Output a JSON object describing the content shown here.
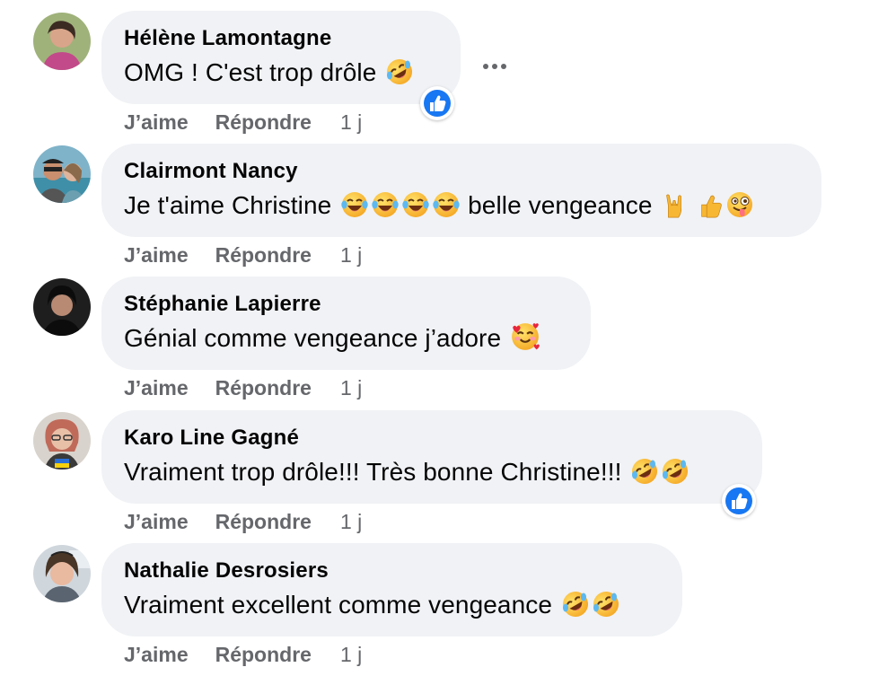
{
  "actions": {
    "like": "J’aime",
    "reply": "Répondre"
  },
  "comments": [
    {
      "author": "Hélène Lamontagne",
      "text": "OMG ! C'est trop drôle",
      "time": "1 j",
      "emojis": [
        "rofl-emoji"
      ],
      "reactions": [
        "like-reaction-icon"
      ]
    },
    {
      "author": "Clairmont Nancy",
      "text": "Je t'aime Christine",
      "text2": "belle vengeance",
      "time": "1 j",
      "emojis": [
        "joy-emoji",
        "joy-emoji",
        "joy-emoji",
        "joy-emoji",
        "rock-on-emoji",
        "thumbs-up-emoji",
        "tongue-wink-emoji"
      ],
      "reactions": []
    },
    {
      "author": "Stéphanie Lapierre",
      "text": "Génial comme vengeance j’adore",
      "time": "1 j",
      "emojis": [
        "smiling-hearts-emoji"
      ],
      "reactions": []
    },
    {
      "author": "Karo Line Gagné",
      "text": "Vraiment trop drôle!!! Très bonne Christine!!!",
      "time": "1 j",
      "emojis": [
        "rofl-emoji",
        "rofl-emoji"
      ],
      "reactions": [
        "like-reaction-icon"
      ]
    },
    {
      "author": "Nathalie Desrosiers",
      "text": "Vraiment excellent comme vengeance",
      "time": "1 j",
      "emojis": [
        "rofl-emoji",
        "rofl-emoji"
      ],
      "reactions": []
    }
  ],
  "colors": {
    "bubble": "#f0f2f5",
    "meta": "#65676b",
    "like_blue": "#1877f2"
  }
}
